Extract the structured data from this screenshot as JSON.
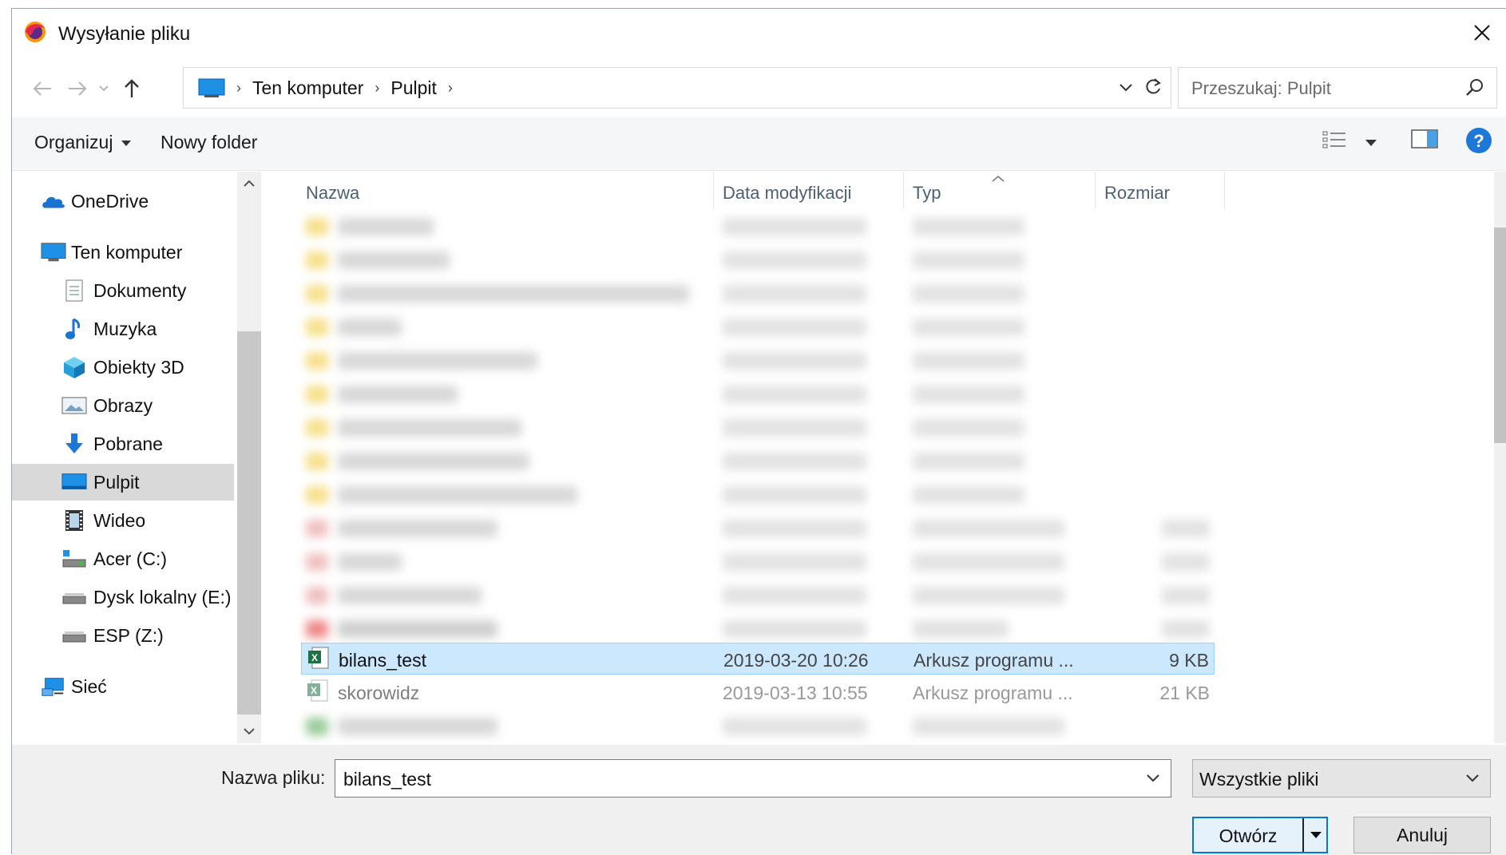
{
  "window": {
    "title": "Wysyłanie pliku"
  },
  "address": {
    "crumbs": [
      "Ten komputer",
      "Pulpit"
    ]
  },
  "search": {
    "placeholder": "Przeszukaj: Pulpit"
  },
  "toolbar": {
    "organize_label": "Organizuj",
    "new_folder_label": "Nowy folder"
  },
  "sidebar": {
    "items": [
      {
        "label": "OneDrive",
        "icon": "onedrive-icon"
      },
      {
        "label": "Ten komputer",
        "icon": "computer-icon"
      },
      {
        "label": "Dokumenty",
        "icon": "documents-icon"
      },
      {
        "label": "Muzyka",
        "icon": "music-icon"
      },
      {
        "label": "Obiekty 3D",
        "icon": "objects-3d-icon"
      },
      {
        "label": "Obrazy",
        "icon": "pictures-icon"
      },
      {
        "label": "Pobrane",
        "icon": "downloads-icon"
      },
      {
        "label": "Pulpit",
        "icon": "desktop-icon",
        "selected": true
      },
      {
        "label": "Wideo",
        "icon": "video-icon"
      },
      {
        "label": "Acer (C:)",
        "icon": "drive-c-icon"
      },
      {
        "label": "Dysk lokalny (E:)",
        "icon": "drive-icon"
      },
      {
        "label": "ESP (Z:)",
        "icon": "drive-icon"
      },
      {
        "label": "Sieć",
        "icon": "network-icon"
      }
    ]
  },
  "files": {
    "columns": [
      "Nazwa",
      "Data modyfikacji",
      "Typ",
      "Rozmiar"
    ],
    "rows": [
      {
        "name": "bilans_test",
        "modified": "2019-03-20 10:26",
        "type": "Arkusz programu ...",
        "size": "9 KB",
        "selected": true
      },
      {
        "name": "skorowidz",
        "modified": "2019-03-13 10:55",
        "type": "Arkusz programu ...",
        "size": "21 KB"
      }
    ]
  },
  "bottom": {
    "filename_label": "Nazwa pliku:",
    "filename_value": "bilans_test",
    "filter_value": "Wszystkie pliki",
    "open_label": "Otwórz",
    "cancel_label": "Anuluj"
  },
  "colors": {
    "accent": "#0078d7",
    "selection": "#cce8ff",
    "help": "#1e78d7"
  }
}
